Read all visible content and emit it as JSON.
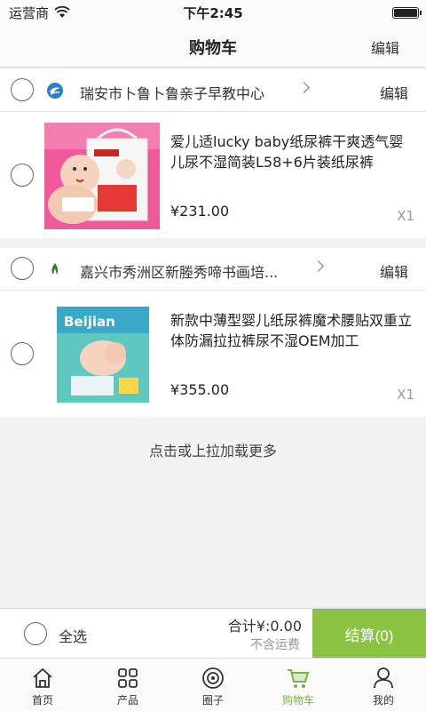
{
  "status": {
    "carrier": "运营商",
    "time": "下午2:45"
  },
  "header": {
    "title": "购物车",
    "edit_label": "编辑"
  },
  "shops": [
    {
      "name": "瑞安市卜鲁卜鲁亲子早教中心",
      "edit_label": "编辑",
      "item": {
        "title": "爱儿适lucky baby纸尿裤干爽透气婴儿尿不湿简装L58+6片装纸尿裤",
        "price": "¥231.00",
        "qty": "X1"
      }
    },
    {
      "name": "嘉兴市秀洲区新塍秀啼书画培...",
      "edit_label": "编辑",
      "item": {
        "title": "新款中薄型婴儿纸尿裤魔术腰贴双重立体防漏拉拉裤尿不湿OEM加工",
        "price": "¥355.00",
        "qty": "X1"
      }
    }
  ],
  "load_more": "点击或上拉加载更多",
  "footer": {
    "select_all": "全选",
    "total": "合计¥:0.00",
    "shipping_note": "不含运费",
    "checkout": "结算(0)"
  },
  "tabs": [
    {
      "label": "首页",
      "icon": "home-icon"
    },
    {
      "label": "产品",
      "icon": "grid-icon"
    },
    {
      "label": "圈子",
      "icon": "circle-icon"
    },
    {
      "label": "购物车",
      "icon": "cart-icon",
      "active": true
    },
    {
      "label": "我的",
      "icon": "user-icon"
    }
  ],
  "colors": {
    "accent": "#8ac342",
    "tab_active": "#7cb342"
  },
  "product_image_text": {
    "brand_2": "Beijian"
  }
}
